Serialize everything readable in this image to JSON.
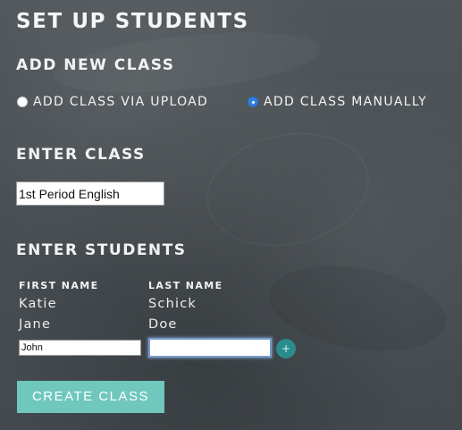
{
  "page": {
    "title": "SET UP STUDENTS"
  },
  "add_class": {
    "heading": "ADD NEW CLASS",
    "options": [
      {
        "label": "ADD CLASS VIA UPLOAD",
        "selected": false
      },
      {
        "label": "ADD CLASS MANUALLY",
        "selected": true
      }
    ]
  },
  "enter_class": {
    "heading": "ENTER CLASS",
    "class_name_value": "1st Period English"
  },
  "enter_students": {
    "heading": "ENTER STUDENTS",
    "columns": [
      "FIRST NAME",
      "LAST NAME"
    ],
    "rows": [
      {
        "first": "Katie",
        "last": "Schick"
      },
      {
        "first": "Jane",
        "last": "Doe"
      }
    ],
    "new_row": {
      "first_value": "John",
      "last_value": ""
    },
    "add_row_icon": "plus-icon",
    "add_row_symbol": "+"
  },
  "actions": {
    "create_label": "CREATE CLASS"
  },
  "colors": {
    "background": "#4a5054",
    "create_button": "#6fc7bd",
    "add_row_button": "#2a8c8c",
    "radio_selected": "#2f7fe0"
  }
}
